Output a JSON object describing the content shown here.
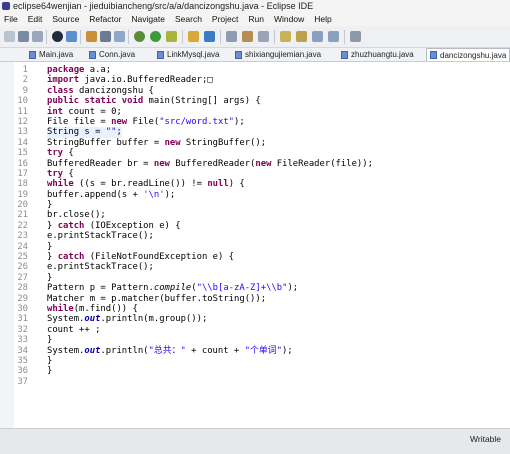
{
  "window": {
    "title": "eclipse64wenjian - jieduibiancheng/src/a/a/dancizongshu.java - Eclipse IDE"
  },
  "menu": [
    "File",
    "Edit",
    "Source",
    "Refactor",
    "Navigate",
    "Search",
    "Project",
    "Run",
    "Window",
    "Help"
  ],
  "tabs": [
    {
      "label": "Main.java",
      "active": false
    },
    {
      "label": "Conn.java",
      "active": false
    },
    {
      "label": "LinkMysql.java",
      "active": false
    },
    {
      "label": "shixiangujiemian.java",
      "active": false
    },
    {
      "label": "zhuzhuangtu.java",
      "active": false
    },
    {
      "label": "dancizongshu.java",
      "active": true
    }
  ],
  "code_lines": [
    {
      "n": "1",
      "text": "package a.a;"
    },
    {
      "n": "2",
      "text": "import java.io.BufferedReader;□"
    },
    {
      "n": "9",
      "text": "class dancizongshu {"
    },
    {
      "n": "10",
      "text": "public static void main(String[] args) {"
    },
    {
      "n": "11",
      "text": "int count = 0;"
    },
    {
      "n": "12",
      "text": "File file = new File(\"src/word.txt\");"
    },
    {
      "n": "13",
      "text": "String s = \"\";"
    },
    {
      "n": "14",
      "text": "StringBuffer buffer = new StringBuffer();"
    },
    {
      "n": "15",
      "text": "try {"
    },
    {
      "n": "16",
      "text": "BufferedReader br = new BufferedReader(new FileReader(file));"
    },
    {
      "n": "17",
      "text": "try {"
    },
    {
      "n": "18",
      "text": "while ((s = br.readLine()) != null) {"
    },
    {
      "n": "19",
      "text": "buffer.append(s + '\\n');"
    },
    {
      "n": "20",
      "text": "}"
    },
    {
      "n": "21",
      "text": "br.close();"
    },
    {
      "n": "22",
      "text": "} catch (IOException e) {"
    },
    {
      "n": "23",
      "text": "e.printStackTrace();"
    },
    {
      "n": "24",
      "text": "}"
    },
    {
      "n": "25",
      "text": "} catch (FileNotFoundException e) {"
    },
    {
      "n": "26",
      "text": "e.printStackTrace();"
    },
    {
      "n": "27",
      "text": "}"
    },
    {
      "n": "28",
      "text": "Pattern p = Pattern.compile(\"\\\\b[a-zA-Z]+\\\\b\");"
    },
    {
      "n": "29",
      "text": "Matcher m = p.matcher(buffer.toString());"
    },
    {
      "n": "30",
      "text": "while(m.find()) {"
    },
    {
      "n": "31",
      "text": "System.out.println(m.group());"
    },
    {
      "n": "32",
      "text": "count ++ ;"
    },
    {
      "n": "33",
      "text": "}"
    },
    {
      "n": "34",
      "text": "System.out.println(\"总共：\" + count + \"个单词\");"
    },
    {
      "n": "35",
      "text": "}"
    },
    {
      "n": "36",
      "text": "}"
    },
    {
      "n": "37",
      "text": ""
    }
  ],
  "status": {
    "mode": "Writable"
  },
  "colors": {
    "keyword": "#7f0055",
    "string": "#2a00ff",
    "field": "#0000c0",
    "line_highlight": "#e8f2fe"
  }
}
